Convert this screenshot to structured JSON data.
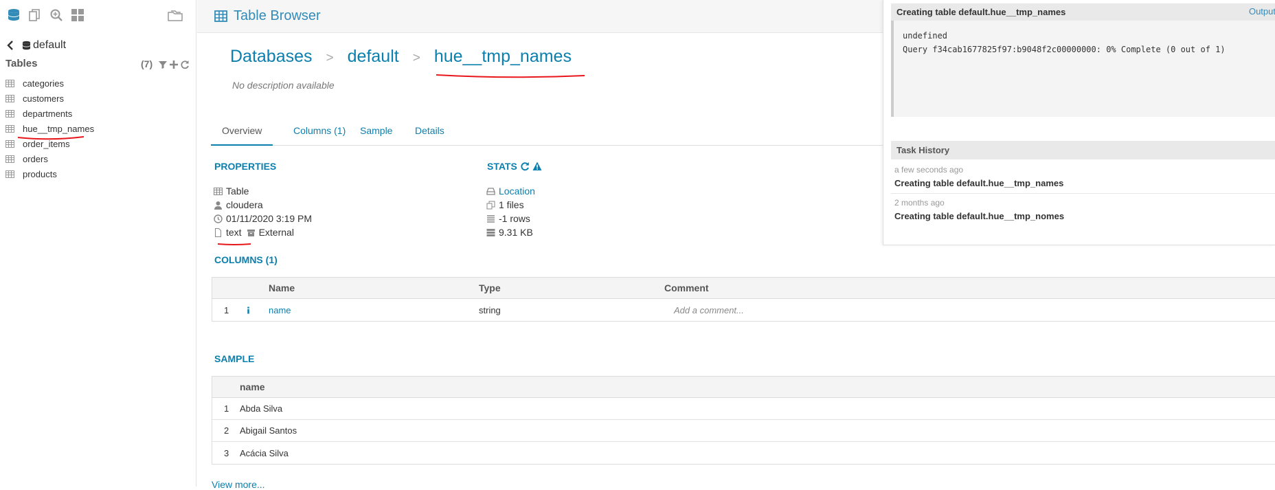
{
  "app": {
    "title": "Table Browser"
  },
  "sidebar": {
    "database": "default",
    "tables_label": "Tables",
    "tables_count": "(7)",
    "tables": [
      "categories",
      "customers",
      "departments",
      "hue__tmp_names",
      "order_items",
      "orders",
      "products"
    ]
  },
  "breadcrumb": {
    "databases": "Databases",
    "sep": ">",
    "db": "default",
    "table": "hue__tmp_names"
  },
  "description": "No description available",
  "tabs": [
    "Overview",
    "Columns (1)",
    "Sample",
    "Details"
  ],
  "properties": {
    "heading": "PROPERTIES",
    "type": "Table",
    "owner": "cloudera",
    "created": "01/11/2020 3:19 PM",
    "format": "text",
    "table_kind": "External"
  },
  "stats": {
    "heading": "STATS",
    "location": "Location",
    "files": "1 files",
    "rows": "-1 rows",
    "size": "9.31 KB"
  },
  "columns": {
    "heading": "COLUMNS (1)",
    "headers": [
      "Name",
      "Type",
      "Comment"
    ],
    "rows": [
      {
        "num": "1",
        "name": "name",
        "type": "string",
        "comment": "Add a comment..."
      }
    ]
  },
  "sample": {
    "heading": "SAMPLE",
    "header": "name",
    "rows": [
      {
        "num": "1",
        "value": "Abda Silva"
      },
      {
        "num": "2",
        "value": "Abigail Santos"
      },
      {
        "num": "3",
        "value": "Acácia Silva"
      }
    ],
    "view_more": "View more..."
  },
  "right_panel": {
    "job_title": "Creating table default.hue__tmp_names",
    "output_label": "Output",
    "log_lines": [
      "undefined",
      "Query f34cab1677825f97:b9048f2c00000000: 0% Complete (0 out of 1)"
    ],
    "task_history_label": "Task History",
    "tasks": [
      {
        "ago": "a few seconds ago",
        "name": "Creating table default.hue__tmp_names"
      },
      {
        "ago": "2 months ago",
        "name": "Creating table default.hue__tmp_nomes"
      }
    ]
  },
  "colors": {
    "accent": "#0b7fad",
    "annotation": "#e8161b"
  }
}
